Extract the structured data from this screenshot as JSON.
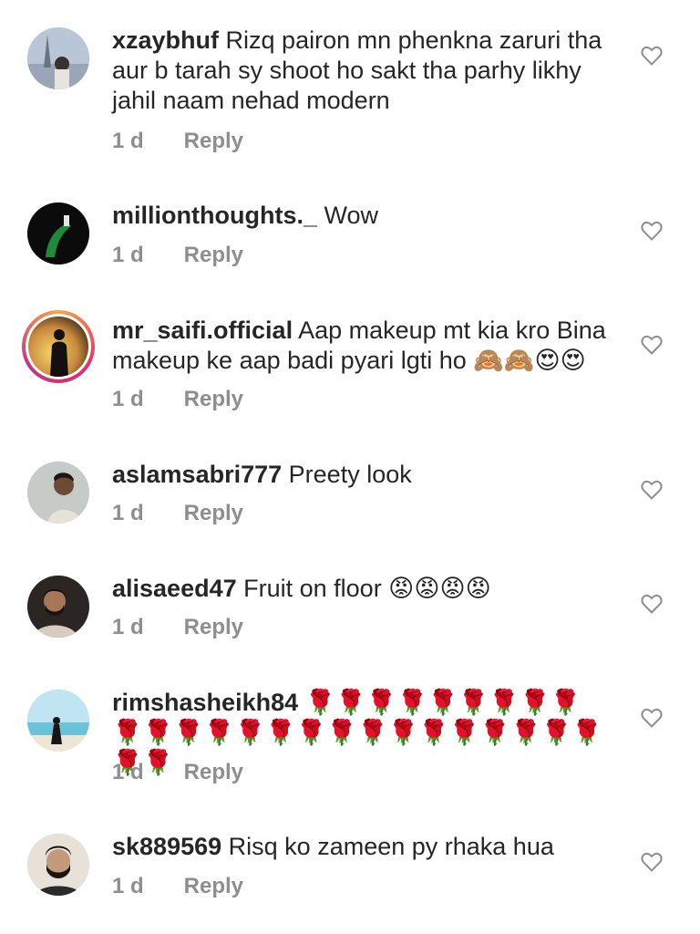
{
  "comments": [
    {
      "username": "xzaybhuf",
      "text": "Rizq pairon mn phenkna zaruri tha aur b tarah sy shoot ho sakt tha parhy likhy jahil naam nehad modern",
      "time": "1 d",
      "reply_label": "Reply",
      "avatar_icon": "user-avatar"
    },
    {
      "username": "millionthoughts._",
      "text": "Wow",
      "time": "1 d",
      "reply_label": "Reply",
      "avatar_icon": "user-avatar"
    },
    {
      "username": "mr_saifi.official",
      "text": "Aap makeup mt kia kro Bina makeup  ke aap badi pyari lgti ho 🙈🙈😍😍",
      "time": "1 d",
      "reply_label": "Reply",
      "avatar_icon": "user-avatar-story-ring"
    },
    {
      "username": "aslamsabri777",
      "text": "Preety look",
      "time": "1 d",
      "reply_label": "Reply",
      "avatar_icon": "user-avatar"
    },
    {
      "username": "alisaeed47",
      "text": "Fruit on floor 😡😡😡😡",
      "time": "1 d",
      "reply_label": "Reply",
      "avatar_icon": "user-avatar"
    },
    {
      "username": "rimshasheikh84",
      "text": "🌹🌹🌹🌹🌹🌹🌹🌹🌹🌹🌹🌹🌹🌹🌹🌹🌹🌹🌹🌹🌹🌹🌹🌹🌹🌹🌹",
      "time": "1 d",
      "reply_label": "Reply",
      "avatar_icon": "user-avatar"
    },
    {
      "username": "sk889569",
      "text": "Risq ko zameen py rhaka hua",
      "time": "1 d",
      "reply_label": "Reply",
      "avatar_icon": "user-avatar"
    }
  ],
  "colors": {
    "text": "#262626",
    "meta": "#8e8e8e",
    "heart_outline": "#8e8e8e",
    "story_ring_start": "#f7a34b",
    "story_ring_end": "#c13584"
  }
}
